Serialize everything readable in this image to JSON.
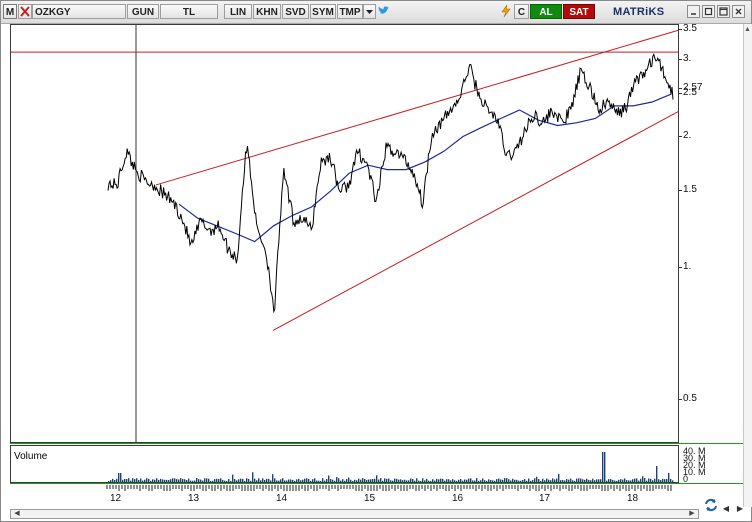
{
  "toolbar": {
    "m_label": "M",
    "symbol": "OZKGY",
    "period": "GUN",
    "currency": "TL",
    "scale": "LIN",
    "khn": "KHN",
    "svd": "SVD",
    "sym": "SYM",
    "tmp": "TMP",
    "c_label": "C",
    "buy_label": "AL",
    "sell_label": "SAT",
    "logo": "MATRiKS",
    "colors": {
      "buy": "#118a11",
      "sell": "#b10b0b",
      "accent": "#1e2f6b"
    }
  },
  "price_axis": {
    "ticks": [
      "3.5",
      "3.",
      "2.57",
      "2.5",
      "2.",
      "1.5",
      "1.",
      "0.5"
    ],
    "tick_values": [
      3.5,
      3.0,
      2.57,
      2.5,
      2.0,
      1.5,
      1.0,
      0.5
    ]
  },
  "volume": {
    "label": "Volume",
    "ticks": [
      "40. M",
      "30. M",
      "20. M",
      "10. M",
      "0"
    ]
  },
  "x_axis": {
    "labels": [
      "12",
      "13",
      "14",
      "15",
      "16",
      "17",
      "18"
    ]
  },
  "chart_data": {
    "type": "line",
    "series": [
      {
        "values": [
          1.56,
          1.55,
          1.85,
          1.68,
          1.58,
          1.55,
          1.48,
          1.42,
          1.3,
          1.12,
          1.28,
          1.22,
          1.25,
          1.1,
          1.05,
          1.92,
          1.25,
          1.1,
          0.78,
          1.65,
          1.28,
          1.3,
          1.22,
          1.75,
          1.8,
          1.5,
          1.55,
          1.85,
          1.72,
          1.4,
          1.88,
          1.85,
          1.78,
          1.65,
          1.4,
          2.05,
          2.15,
          2.3,
          2.45,
          2.9,
          2.5,
          2.3,
          2.2,
          1.8,
          1.85,
          2.05,
          2.25,
          2.15,
          2.3,
          2.15,
          2.3,
          2.8,
          2.6,
          2.3,
          2.4,
          2.25,
          2.35,
          2.7,
          2.8,
          3.05,
          2.8,
          2.5
        ]
      },
      {
        "values": [
          1.4,
          1.3,
          1.25,
          1.2,
          1.15,
          1.25,
          1.32,
          1.38,
          1.5,
          1.65,
          1.72,
          1.68,
          1.68,
          1.75,
          1.85,
          2.0,
          2.1,
          2.2,
          2.3,
          2.18,
          2.12,
          2.15,
          2.2,
          2.35,
          2.35,
          2.4,
          2.5
        ]
      }
    ],
    "ylim": [
      0.4,
      3.6
    ],
    "log_scale": true,
    "horizontal_level": 3.12,
    "channel_upper": [
      [
        0,
        1.55
      ],
      [
        1,
        3.5
      ]
    ],
    "channel_lower": [
      [
        0,
        0.72
      ],
      [
        1,
        2.28
      ]
    ],
    "colors": {
      "price": "#000000",
      "average": "#1c2a9c",
      "channel": "#c51c1c"
    }
  }
}
